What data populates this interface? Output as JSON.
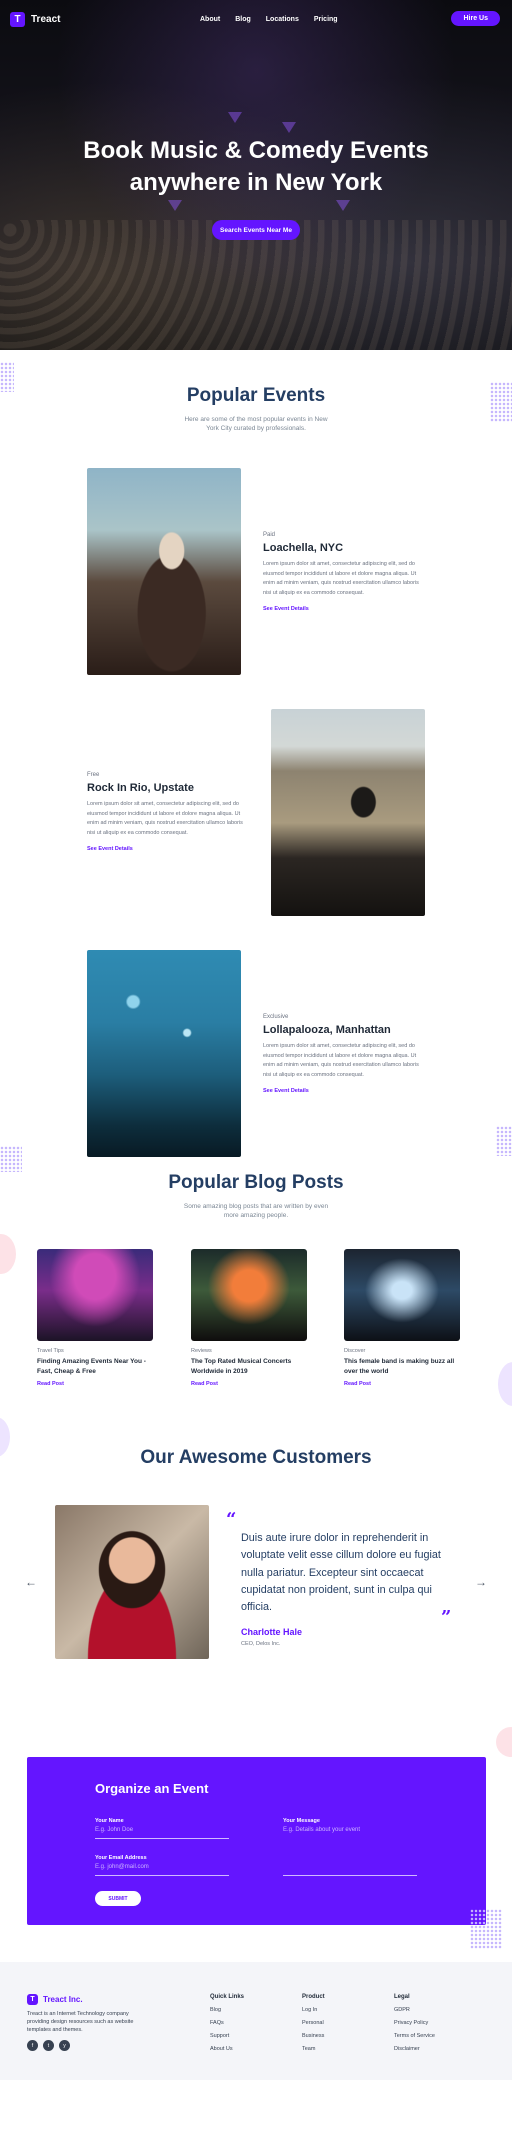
{
  "nav": {
    "brand": "Treact",
    "logo_letter": "T",
    "links": [
      "About",
      "Blog",
      "Locations",
      "Pricing"
    ],
    "cta": "Hire Us"
  },
  "hero": {
    "title_line1": "Book Music & Comedy Events",
    "title_line2": "anywhere in New York",
    "cta": "Search Events Near Me"
  },
  "popular": {
    "title": "Popular Events",
    "description": "Here are some of the most popular events in New York City curated by professionals.",
    "events": [
      {
        "badge": "Paid",
        "title": "Loachella, NYC",
        "description": "Lorem ipsum dolor sit amet, consectetur adipiscing elit, sed do eiusmod tempor incididunt ut labore et dolore magna aliqua. Ut enim ad minim veniam, quis nostrud exercitation ullamco laboris nisi ut aliquip ex ea commodo consequat.",
        "link": "See Event Details"
      },
      {
        "badge": "Free",
        "title": "Rock In Rio, Upstate",
        "description": "Lorem ipsum dolor sit amet, consectetur adipiscing elit, sed do eiusmod tempor incididunt ut labore et dolore magna aliqua. Ut enim ad minim veniam, quis nostrud exercitation ullamco laboris nisi ut aliquip ex ea commodo consequat.",
        "link": "See Event Details"
      },
      {
        "badge": "Exclusive",
        "title": "Lollapalooza, Manhattan",
        "description": "Lorem ipsum dolor sit amet, consectetur adipiscing elit, sed do eiusmod tempor incididunt ut labore et dolore magna aliqua. Ut enim ad minim veniam, quis nostrud exercitation ullamco laboris nisi ut aliquip ex ea commodo consequat.",
        "link": "See Event Details"
      }
    ]
  },
  "blog": {
    "title": "Popular Blog Posts",
    "description": "Some amazing blog posts that are written by even more amazing people.",
    "posts": [
      {
        "category": "Travel Tips",
        "title": "Finding Amazing Events Near You - Fast, Cheap & Free",
        "link": "Read Post"
      },
      {
        "category": "Reviews",
        "title": "The Top Rated Musical Concerts Worldwide in 2019",
        "link": "Read Post"
      },
      {
        "category": "Discover",
        "title": "This female band is making buzz all over the world",
        "link": "Read Post"
      }
    ]
  },
  "customers": {
    "title": "Our Awesome Customers",
    "quote": "Duis aute irure dolor in reprehenderit in voluptate velit esse cillum dolore eu fugiat nulla pariatur. Excepteur sint occaecat cupidatat non proident, sunt in culpa qui officia.",
    "name": "Charlotte Hale",
    "role": "CEO, Delos Inc.",
    "prev_arrow": "←",
    "next_arrow": "→"
  },
  "organize": {
    "title": "Organize an Event",
    "name_label": "Your Name",
    "name_placeholder": "E.g. John Doe",
    "email_label": "Your Email Address",
    "email_placeholder": "E.g. john@mail.com",
    "message_label": "Your Message",
    "message_placeholder": "E.g. Details about your event",
    "submit": "SUBMIT"
  },
  "footer": {
    "brand": "Treact Inc.",
    "description": "Treact is an Internet Technology company providing design resources such as website templates and themes.",
    "social": [
      "f",
      "t",
      "y"
    ],
    "columns": [
      {
        "title": "Quick Links",
        "items": [
          "Blog",
          "FAQs",
          "Support",
          "About Us"
        ]
      },
      {
        "title": "Product",
        "items": [
          "Log In",
          "Personal",
          "Business",
          "Team"
        ]
      },
      {
        "title": "Legal",
        "items": [
          "GDPR",
          "Privacy Policy",
          "Terms of Service",
          "Disclaimer"
        ]
      }
    ]
  },
  "colors": {
    "primary": "#6415ff",
    "heading": "#243e63",
    "footer_bg": "#f4f5f9"
  }
}
